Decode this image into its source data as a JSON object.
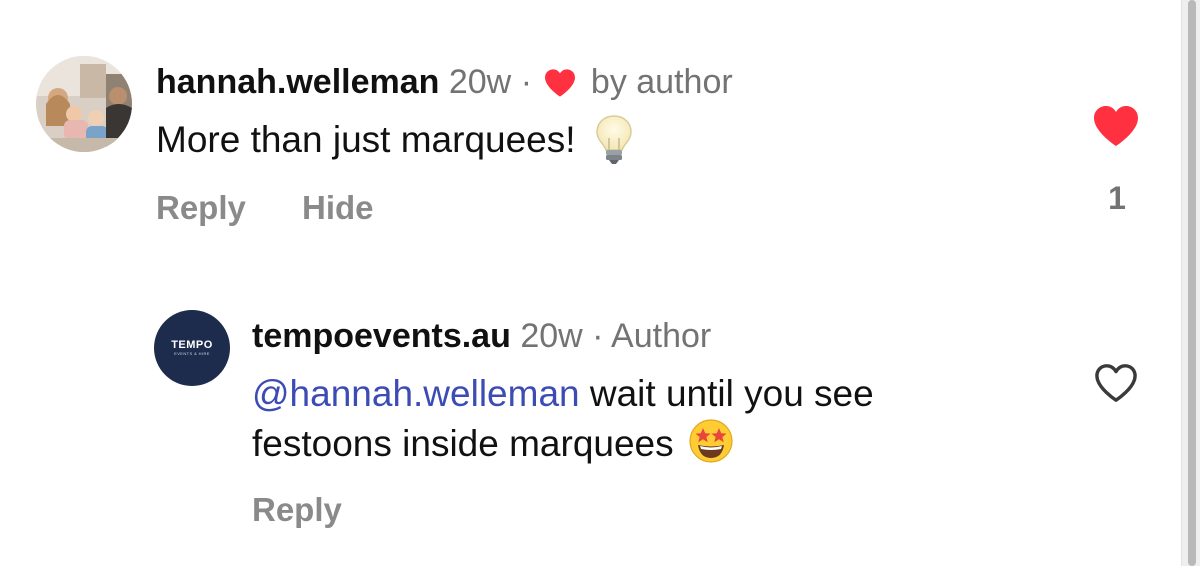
{
  "comments": [
    {
      "username": "hannah.welleman",
      "time": "20w",
      "separator": "·",
      "liked_by_author_label": "by author",
      "text": "More than just marquees!",
      "emoji_icon": "light-bulb-icon",
      "actions": {
        "reply": "Reply",
        "hide": "Hide"
      },
      "like_count": "1",
      "liked": true
    },
    {
      "username": "tempoevents.au",
      "time": "20w",
      "separator": "·",
      "author_label": "Author",
      "avatar_logo_text": "TEMPO",
      "avatar_logo_subtext": "EVENTS & HIRE",
      "mention": "@hannah.welleman",
      "text": " wait until you see festoons inside marquees",
      "emoji_icon": "star-struck-icon",
      "actions": {
        "reply": "Reply"
      },
      "liked": false
    }
  ],
  "colors": {
    "heart_red": "#ff3040",
    "mention_blue": "#3d4cb5",
    "muted_gray": "#737373",
    "avatar_navy": "#1d2b4c"
  }
}
